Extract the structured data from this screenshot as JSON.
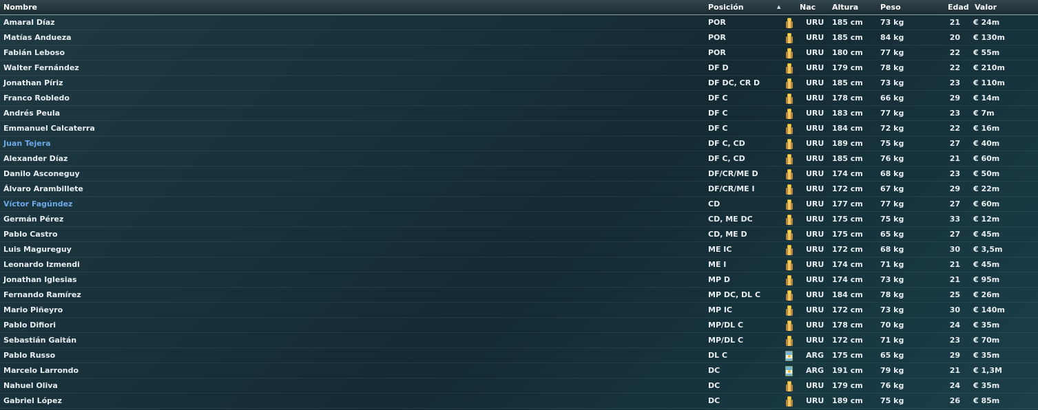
{
  "headers": {
    "name": "Nombre",
    "position": "Posición",
    "sort_indicator": "▲",
    "nationality": "Nac",
    "height": "Altura",
    "weight": "Peso",
    "age": "Edad",
    "value": "Valor"
  },
  "colors": {
    "link_name": "#6ea8e8",
    "text": "#e9eef0"
  },
  "players": [
    {
      "name": "Amaral Díaz",
      "position": "POR",
      "flag": "uruguay-flag-icon",
      "nat": "URU",
      "height": "185 cm",
      "weight": "73 kg",
      "age": "21",
      "value": "€ 24m",
      "linked": false
    },
    {
      "name": "Matías Andueza",
      "position": "POR",
      "flag": "uruguay-flag-icon",
      "nat": "URU",
      "height": "185 cm",
      "weight": "84 kg",
      "age": "20",
      "value": "€ 130m",
      "linked": false
    },
    {
      "name": "Fabián Leboso",
      "position": "POR",
      "flag": "uruguay-flag-icon",
      "nat": "URU",
      "height": "180 cm",
      "weight": "77 kg",
      "age": "22",
      "value": "€ 55m",
      "linked": false
    },
    {
      "name": "Walter Fernández",
      "position": "DF D",
      "flag": "uruguay-flag-icon",
      "nat": "URU",
      "height": "179 cm",
      "weight": "78 kg",
      "age": "22",
      "value": "€ 210m",
      "linked": false
    },
    {
      "name": "Jonathan Píriz",
      "position": "DF DC, CR D",
      "flag": "uruguay-flag-icon",
      "nat": "URU",
      "height": "185 cm",
      "weight": "73 kg",
      "age": "23",
      "value": "€ 110m",
      "linked": false
    },
    {
      "name": "Franco Robledo",
      "position": "DF C",
      "flag": "uruguay-flag-icon",
      "nat": "URU",
      "height": "178 cm",
      "weight": "66 kg",
      "age": "29",
      "value": "€ 14m",
      "linked": false
    },
    {
      "name": "Andrés Peula",
      "position": "DF C",
      "flag": "uruguay-flag-icon",
      "nat": "URU",
      "height": "183 cm",
      "weight": "77 kg",
      "age": "23",
      "value": "€ 7m",
      "linked": false
    },
    {
      "name": "Emmanuel Calcaterra",
      "position": "DF C",
      "flag": "uruguay-flag-icon",
      "nat": "URU",
      "height": "184 cm",
      "weight": "72 kg",
      "age": "22",
      "value": "€ 16m",
      "linked": false
    },
    {
      "name": "Juan Tejera",
      "position": "DF C, CD",
      "flag": "uruguay-flag-icon",
      "nat": "URU",
      "height": "189 cm",
      "weight": "75 kg",
      "age": "27",
      "value": "€ 40m",
      "linked": true
    },
    {
      "name": "Alexander Díaz",
      "position": "DF C, CD",
      "flag": "uruguay-flag-icon",
      "nat": "URU",
      "height": "185 cm",
      "weight": "76 kg",
      "age": "21",
      "value": "€ 60m",
      "linked": false
    },
    {
      "name": "Danilo Asconeguy",
      "position": "DF/CR/ME D",
      "flag": "uruguay-flag-icon",
      "nat": "URU",
      "height": "174 cm",
      "weight": "68 kg",
      "age": "23",
      "value": "€ 50m",
      "linked": false
    },
    {
      "name": "Álvaro Arambillete",
      "position": "DF/CR/ME I",
      "flag": "uruguay-flag-icon",
      "nat": "URU",
      "height": "172 cm",
      "weight": "67 kg",
      "age": "29",
      "value": "€ 22m",
      "linked": false
    },
    {
      "name": "Víctor Fagúndez",
      "position": "CD",
      "flag": "uruguay-flag-icon",
      "nat": "URU",
      "height": "177 cm",
      "weight": "77 kg",
      "age": "27",
      "value": "€ 60m",
      "linked": true
    },
    {
      "name": "Germán Pérez",
      "position": "CD, ME DC",
      "flag": "uruguay-flag-icon",
      "nat": "URU",
      "height": "175 cm",
      "weight": "75 kg",
      "age": "33",
      "value": "€ 12m",
      "linked": false
    },
    {
      "name": "Pablo Castro",
      "position": "CD, ME D",
      "flag": "uruguay-flag-icon",
      "nat": "URU",
      "height": "175 cm",
      "weight": "65 kg",
      "age": "27",
      "value": "€ 45m",
      "linked": false
    },
    {
      "name": "Luis Magureguy",
      "position": "ME IC",
      "flag": "uruguay-flag-icon",
      "nat": "URU",
      "height": "172 cm",
      "weight": "68 kg",
      "age": "30",
      "value": "€ 3,5m",
      "linked": false
    },
    {
      "name": "Leonardo Izmendi",
      "position": "ME I",
      "flag": "uruguay-flag-icon",
      "nat": "URU",
      "height": "174 cm",
      "weight": "71 kg",
      "age": "21",
      "value": "€ 45m",
      "linked": false
    },
    {
      "name": "Jonathan Iglesias",
      "position": "MP D",
      "flag": "uruguay-flag-icon",
      "nat": "URU",
      "height": "174 cm",
      "weight": "73 kg",
      "age": "21",
      "value": "€ 95m",
      "linked": false
    },
    {
      "name": "Fernando Ramírez",
      "position": "MP DC, DL C",
      "flag": "uruguay-flag-icon",
      "nat": "URU",
      "height": "184 cm",
      "weight": "78 kg",
      "age": "25",
      "value": "€ 26m",
      "linked": false
    },
    {
      "name": "Mario Piñeyro",
      "position": "MP IC",
      "flag": "uruguay-flag-icon",
      "nat": "URU",
      "height": "172 cm",
      "weight": "73 kg",
      "age": "30",
      "value": "€ 140m",
      "linked": false
    },
    {
      "name": "Pablo Difiori",
      "position": "MP/DL C",
      "flag": "uruguay-flag-icon",
      "nat": "URU",
      "height": "178 cm",
      "weight": "70 kg",
      "age": "24",
      "value": "€ 35m",
      "linked": false
    },
    {
      "name": "Sebastián Gaitán",
      "position": "MP/DL C",
      "flag": "uruguay-flag-icon",
      "nat": "URU",
      "height": "172 cm",
      "weight": "71 kg",
      "age": "23",
      "value": "€ 70m",
      "linked": false
    },
    {
      "name": "Pablo Russo",
      "position": "DL C",
      "flag": "argentina-flag-icon",
      "nat": "ARG",
      "height": "175 cm",
      "weight": "65 kg",
      "age": "29",
      "value": "€ 35m",
      "linked": false
    },
    {
      "name": "Marcelo Larrondo",
      "position": "DC",
      "flag": "argentina-flag-icon",
      "nat": "ARG",
      "height": "191 cm",
      "weight": "79 kg",
      "age": "21",
      "value": "€ 1,3M",
      "linked": false
    },
    {
      "name": "Nahuel Oliva",
      "position": "DC",
      "flag": "uruguay-flag-icon",
      "nat": "URU",
      "height": "179 cm",
      "weight": "76 kg",
      "age": "24",
      "value": "€ 35m",
      "linked": false
    },
    {
      "name": "Gabriel López",
      "position": "DC",
      "flag": "uruguay-flag-icon",
      "nat": "URU",
      "height": "189 cm",
      "weight": "75 kg",
      "age": "26",
      "value": "€ 85m",
      "linked": false
    }
  ]
}
